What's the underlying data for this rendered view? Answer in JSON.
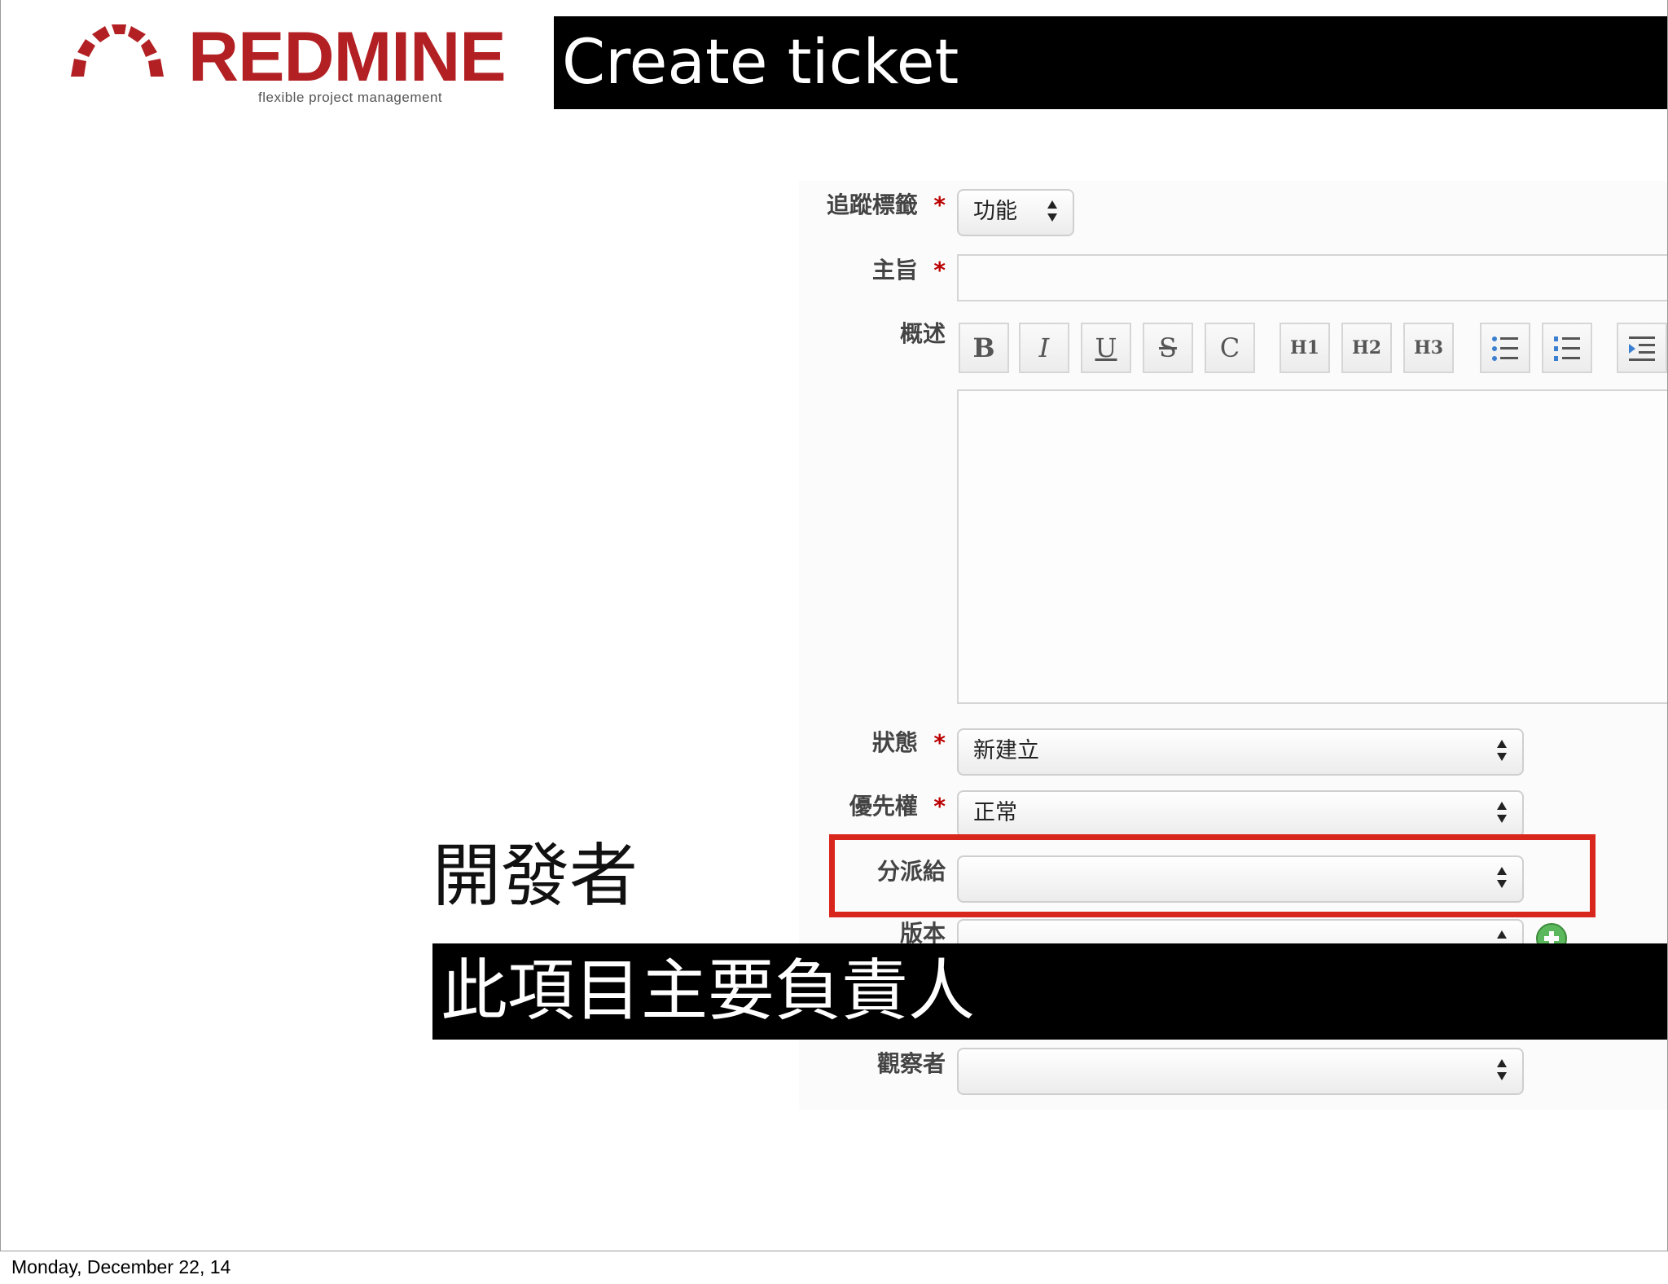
{
  "logo": {
    "wordmark": "REDMINE",
    "tagline": "flexible project management"
  },
  "slide_title": "Create ticket",
  "form": {
    "tracker": {
      "label": "追蹤標籤",
      "required_mark": "*",
      "value": "功能"
    },
    "subject": {
      "label": "主旨",
      "required_mark": "*",
      "value": ""
    },
    "description": {
      "label": "概述",
      "toolbar": [
        "B",
        "I",
        "U",
        "S",
        "C",
        "H1",
        "H2",
        "H3"
      ],
      "value": ""
    },
    "status": {
      "label": "狀態",
      "required_mark": "*",
      "value": "新建立"
    },
    "priority": {
      "label": "優先權",
      "required_mark": "*",
      "value": "正常"
    },
    "assignee": {
      "label": "分派給",
      "value": ""
    },
    "version": {
      "label": "版本",
      "value": ""
    },
    "watchers": {
      "label": "觀察者",
      "value": ""
    }
  },
  "annotation": {
    "heading": "開發者",
    "caption": "此項目主要負責人",
    "highlight_color": "#d8261c"
  },
  "footer": {
    "date": "Monday, December 22, 14"
  },
  "colors": {
    "brand": "#b32024",
    "required": "#bb0000"
  }
}
